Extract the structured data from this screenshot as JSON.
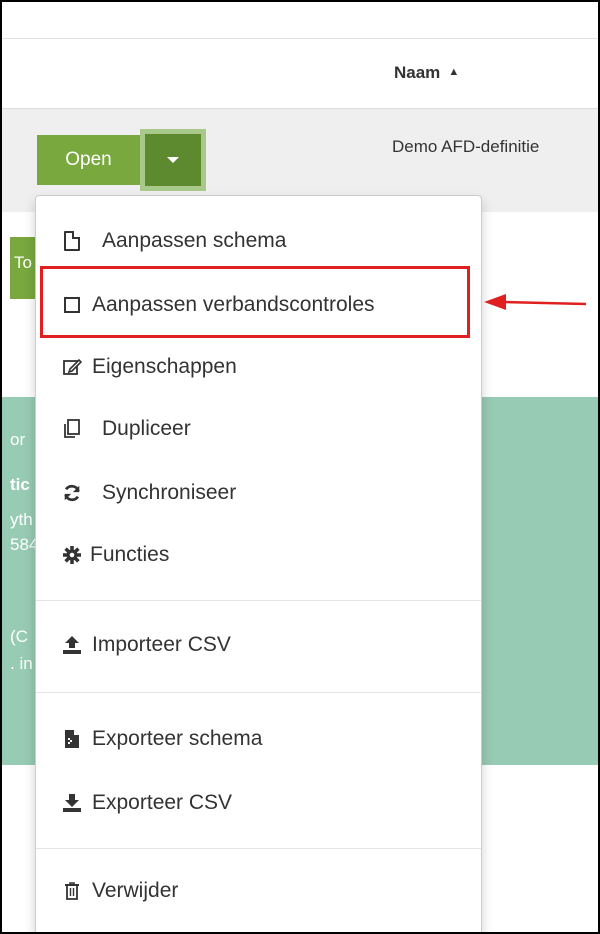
{
  "table": {
    "header": {
      "name_col": "Naam",
      "sort_indicator": "▲"
    },
    "row": {
      "name": "Demo AFD-definitie"
    }
  },
  "row_actions": {
    "open_label": "Open",
    "toggle_icon": "caret-down-icon"
  },
  "background": {
    "button_fragment": "To",
    "text_fragments": [
      "or",
      "tic",
      "yth",
      "584",
      "(C",
      ". in"
    ]
  },
  "dropdown": {
    "items": [
      {
        "label": "Aanpassen schema",
        "icon": "file-icon"
      },
      {
        "label": "Aanpassen verbandscontroles",
        "icon": "square-icon",
        "highlighted": true
      },
      {
        "label": "Eigenschappen",
        "icon": "edit-icon"
      },
      {
        "label": "Dupliceer",
        "icon": "copy-icon"
      },
      {
        "label": "Synchroniseer",
        "icon": "sync-icon"
      },
      {
        "label": "Functies",
        "icon": "gear-icon"
      },
      {
        "label": "Importeer CSV",
        "icon": "upload-icon"
      },
      {
        "label": "Exporteer schema",
        "icon": "file-export-icon"
      },
      {
        "label": "Exporteer CSV",
        "icon": "download-icon"
      },
      {
        "label": "Verwijder",
        "icon": "trash-icon"
      }
    ]
  },
  "colors": {
    "primary_green": "#78a83e",
    "toggle_green": "#5d8a2e",
    "panel_teal": "#98cbb4",
    "highlight_red": "#e02020"
  }
}
